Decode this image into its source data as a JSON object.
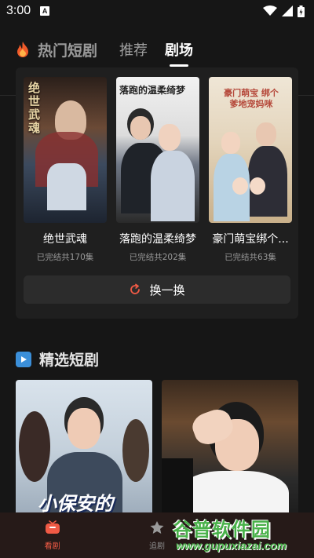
{
  "status": {
    "time": "3:00",
    "notif_badge": "A"
  },
  "header": {
    "title": "热门短剧",
    "tabs": [
      {
        "label": "推荐",
        "active": false
      },
      {
        "label": "剧场",
        "active": true
      }
    ]
  },
  "theater": {
    "cards": [
      {
        "title": "绝世武魂",
        "sub": "已完结共170集",
        "poster_text": "绝世武魂"
      },
      {
        "title": "落跑的温柔绮梦",
        "sub": "已完结共202集",
        "poster_text": "落跑的温柔绮梦"
      },
      {
        "title": "豪门萌宝绑个...",
        "sub": "已完结共63集",
        "poster_text": "豪门萌宝 绑个爹地宠妈咪"
      }
    ],
    "refresh_label": "换一换"
  },
  "section": {
    "title": "精选短剧",
    "pick_poster_text": "小保安的"
  },
  "nav": {
    "items": [
      {
        "label": "看剧"
      },
      {
        "label": "追剧"
      },
      {
        "label": ""
      }
    ]
  },
  "watermark": {
    "main": "谷普软件园",
    "sub": "www.gupuxiazai.com"
  },
  "colors": {
    "accent": "#f05a45",
    "background": "#161616",
    "panel": "#1f1f1f",
    "watermark": "#49b24a"
  }
}
